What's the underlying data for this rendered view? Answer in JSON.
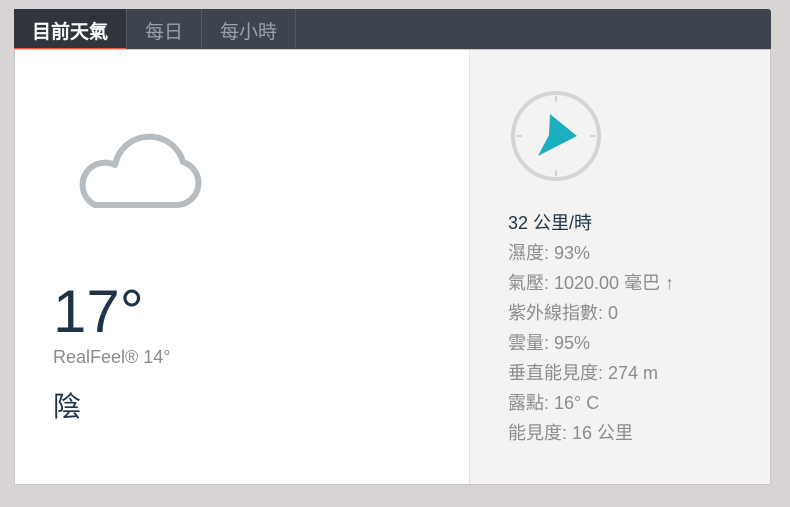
{
  "tabs": [
    {
      "label": "目前天氣",
      "active": true
    },
    {
      "label": "每日",
      "active": false
    },
    {
      "label": "每小時",
      "active": false
    }
  ],
  "current": {
    "condition_icon": "cloud-icon",
    "temperature": "17°",
    "realfeel": "RealFeel® 14°",
    "condition": "陰"
  },
  "wind": {
    "icon": "compass-icon",
    "speed": "32 公里/時"
  },
  "details": {
    "humidity": "濕度: 93%",
    "pressure": "氣壓: 1020.00 毫巴 ↑",
    "uv_index": "紫外線指數: 0",
    "cloud_cover": "雲量: 95%",
    "ceiling": "垂直能見度: 274 m",
    "dew_point": "露點: 16° C",
    "visibility": "能見度: 16 公里"
  },
  "colors": {
    "tab_bar": "#3d444d",
    "tab_accent": "#f0612a",
    "primary_text": "#1d3347",
    "secondary_text": "#8c8c8c",
    "compass_needle": "#1ab0c0",
    "cloud_stroke": "#b7bcc0"
  }
}
